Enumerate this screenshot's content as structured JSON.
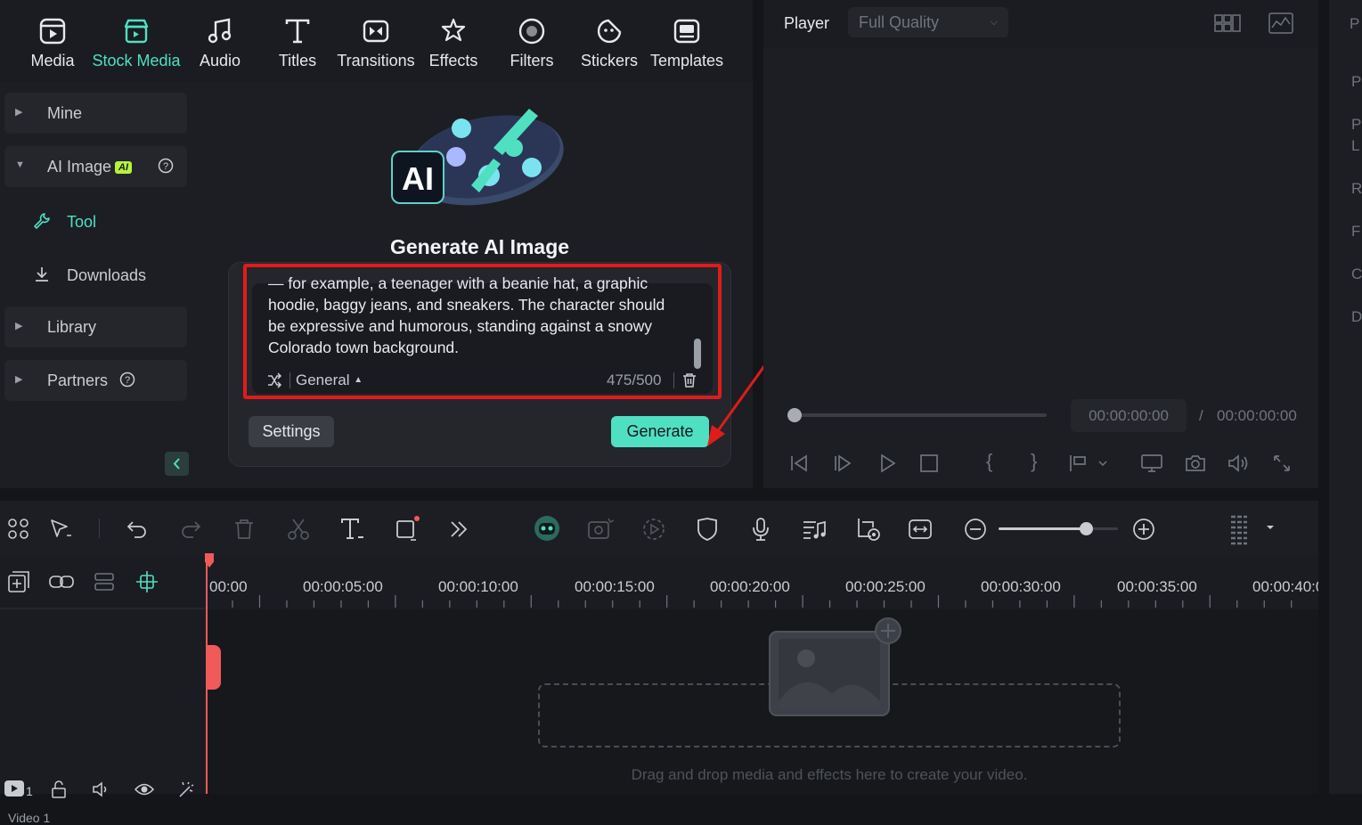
{
  "tabs": [
    {
      "label": "Media",
      "icon": "media-icon"
    },
    {
      "label": "Stock Media",
      "icon": "stock-media-icon",
      "active": true
    },
    {
      "label": "Audio",
      "icon": "audio-note-icon"
    },
    {
      "label": "Titles",
      "icon": "titles-t-icon"
    },
    {
      "label": "Transitions",
      "icon": "transitions-icon"
    },
    {
      "label": "Effects",
      "icon": "effects-icon"
    },
    {
      "label": "Filters",
      "icon": "filters-icon"
    },
    {
      "label": "Stickers",
      "icon": "stickers-icon"
    },
    {
      "label": "Templates",
      "icon": "templates-icon"
    }
  ],
  "sidebar": {
    "mine": "Mine",
    "ai_image": "AI Image",
    "ai_badge": "AI",
    "tool": "Tool",
    "downloads": "Downloads",
    "library": "Library",
    "partners": "Partners"
  },
  "generator": {
    "title": "Generate AI Image",
    "prompt_lines": [
      "— for example, a teenager with a beanie hat, a graphic",
      "hoodie, baggy jeans, and sneakers. The character should",
      "be expressive and humorous, standing against a snowy",
      "Colorado town background."
    ],
    "style": "General",
    "char_count": "475/500",
    "settings_label": "Settings",
    "generate_label": "Generate"
  },
  "player": {
    "label": "Player",
    "quality": "Full Quality",
    "current_time": "00:00:00:00",
    "separator": "/",
    "total_time": "00:00:00:00"
  },
  "right_strip": {
    "letters": [
      "P",
      "P",
      "P",
      "L",
      "R",
      "F",
      "C",
      "D"
    ]
  },
  "timeline": {
    "ruler_labels": [
      "00:00",
      "00:00:05:00",
      "00:00:10:00",
      "00:00:15:00",
      "00:00:20:00",
      "00:00:25:00",
      "00:00:30:00",
      "00:00:35:00",
      "00:00:40:0"
    ],
    "track_number": "1",
    "track_name": "Video 1",
    "drop_hint": "Drag and drop media and effects here to create your video.",
    "zoom_level": 0.73
  },
  "colors": {
    "accent": "#4fe0c2",
    "highlight_red": "#e01b1b",
    "playhead": "#f05a5a"
  }
}
